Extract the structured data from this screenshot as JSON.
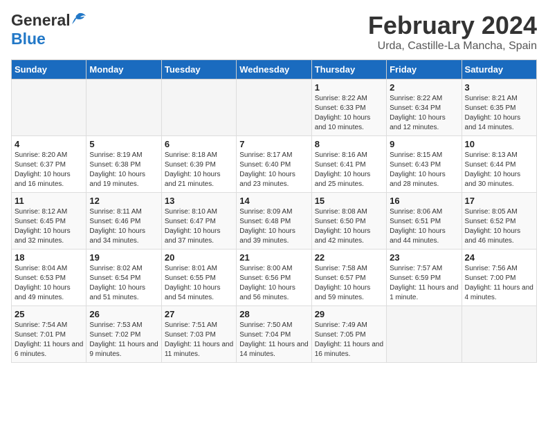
{
  "header": {
    "logo_general": "General",
    "logo_blue": "Blue",
    "month_year": "February 2024",
    "location": "Urda, Castille-La Mancha, Spain"
  },
  "weekdays": [
    "Sunday",
    "Monday",
    "Tuesday",
    "Wednesday",
    "Thursday",
    "Friday",
    "Saturday"
  ],
  "weeks": [
    [
      {
        "day": "",
        "info": ""
      },
      {
        "day": "",
        "info": ""
      },
      {
        "day": "",
        "info": ""
      },
      {
        "day": "",
        "info": ""
      },
      {
        "day": "1",
        "info": "Sunrise: 8:22 AM\nSunset: 6:33 PM\nDaylight: 10 hours and 10 minutes."
      },
      {
        "day": "2",
        "info": "Sunrise: 8:22 AM\nSunset: 6:34 PM\nDaylight: 10 hours and 12 minutes."
      },
      {
        "day": "3",
        "info": "Sunrise: 8:21 AM\nSunset: 6:35 PM\nDaylight: 10 hours and 14 minutes."
      }
    ],
    [
      {
        "day": "4",
        "info": "Sunrise: 8:20 AM\nSunset: 6:37 PM\nDaylight: 10 hours and 16 minutes."
      },
      {
        "day": "5",
        "info": "Sunrise: 8:19 AM\nSunset: 6:38 PM\nDaylight: 10 hours and 19 minutes."
      },
      {
        "day": "6",
        "info": "Sunrise: 8:18 AM\nSunset: 6:39 PM\nDaylight: 10 hours and 21 minutes."
      },
      {
        "day": "7",
        "info": "Sunrise: 8:17 AM\nSunset: 6:40 PM\nDaylight: 10 hours and 23 minutes."
      },
      {
        "day": "8",
        "info": "Sunrise: 8:16 AM\nSunset: 6:41 PM\nDaylight: 10 hours and 25 minutes."
      },
      {
        "day": "9",
        "info": "Sunrise: 8:15 AM\nSunset: 6:43 PM\nDaylight: 10 hours and 28 minutes."
      },
      {
        "day": "10",
        "info": "Sunrise: 8:13 AM\nSunset: 6:44 PM\nDaylight: 10 hours and 30 minutes."
      }
    ],
    [
      {
        "day": "11",
        "info": "Sunrise: 8:12 AM\nSunset: 6:45 PM\nDaylight: 10 hours and 32 minutes."
      },
      {
        "day": "12",
        "info": "Sunrise: 8:11 AM\nSunset: 6:46 PM\nDaylight: 10 hours and 34 minutes."
      },
      {
        "day": "13",
        "info": "Sunrise: 8:10 AM\nSunset: 6:47 PM\nDaylight: 10 hours and 37 minutes."
      },
      {
        "day": "14",
        "info": "Sunrise: 8:09 AM\nSunset: 6:48 PM\nDaylight: 10 hours and 39 minutes."
      },
      {
        "day": "15",
        "info": "Sunrise: 8:08 AM\nSunset: 6:50 PM\nDaylight: 10 hours and 42 minutes."
      },
      {
        "day": "16",
        "info": "Sunrise: 8:06 AM\nSunset: 6:51 PM\nDaylight: 10 hours and 44 minutes."
      },
      {
        "day": "17",
        "info": "Sunrise: 8:05 AM\nSunset: 6:52 PM\nDaylight: 10 hours and 46 minutes."
      }
    ],
    [
      {
        "day": "18",
        "info": "Sunrise: 8:04 AM\nSunset: 6:53 PM\nDaylight: 10 hours and 49 minutes."
      },
      {
        "day": "19",
        "info": "Sunrise: 8:02 AM\nSunset: 6:54 PM\nDaylight: 10 hours and 51 minutes."
      },
      {
        "day": "20",
        "info": "Sunrise: 8:01 AM\nSunset: 6:55 PM\nDaylight: 10 hours and 54 minutes."
      },
      {
        "day": "21",
        "info": "Sunrise: 8:00 AM\nSunset: 6:56 PM\nDaylight: 10 hours and 56 minutes."
      },
      {
        "day": "22",
        "info": "Sunrise: 7:58 AM\nSunset: 6:57 PM\nDaylight: 10 hours and 59 minutes."
      },
      {
        "day": "23",
        "info": "Sunrise: 7:57 AM\nSunset: 6:59 PM\nDaylight: 11 hours and 1 minute."
      },
      {
        "day": "24",
        "info": "Sunrise: 7:56 AM\nSunset: 7:00 PM\nDaylight: 11 hours and 4 minutes."
      }
    ],
    [
      {
        "day": "25",
        "info": "Sunrise: 7:54 AM\nSunset: 7:01 PM\nDaylight: 11 hours and 6 minutes."
      },
      {
        "day": "26",
        "info": "Sunrise: 7:53 AM\nSunset: 7:02 PM\nDaylight: 11 hours and 9 minutes."
      },
      {
        "day": "27",
        "info": "Sunrise: 7:51 AM\nSunset: 7:03 PM\nDaylight: 11 hours and 11 minutes."
      },
      {
        "day": "28",
        "info": "Sunrise: 7:50 AM\nSunset: 7:04 PM\nDaylight: 11 hours and 14 minutes."
      },
      {
        "day": "29",
        "info": "Sunrise: 7:49 AM\nSunset: 7:05 PM\nDaylight: 11 hours and 16 minutes."
      },
      {
        "day": "",
        "info": ""
      },
      {
        "day": "",
        "info": ""
      }
    ]
  ]
}
